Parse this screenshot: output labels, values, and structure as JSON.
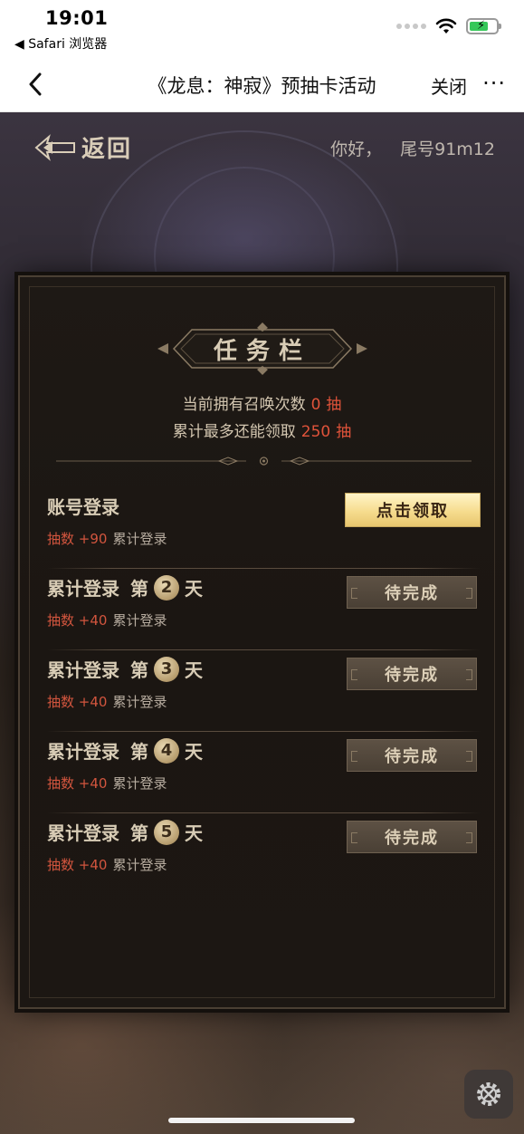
{
  "status_bar": {
    "time": "19:01",
    "back_app": "◀ Safari 浏览器",
    "battery_color": "#35c759"
  },
  "nav_bar": {
    "title": "《龙息：神寂》预抽卡活动",
    "close_label": "关闭",
    "more_label": "···"
  },
  "game_header": {
    "back_label": "返回",
    "greeting": "你好，",
    "tail_label": "尾号91m12"
  },
  "panel": {
    "title": "任务栏",
    "summary": {
      "current_prefix": "当前拥有召唤次数",
      "current_value": "0",
      "current_unit": "抽",
      "max_prefix": "累计最多还能领取",
      "max_value": "250",
      "max_unit": "抽"
    },
    "tasks": [
      {
        "title": "账号登录",
        "day": "",
        "reward": "抽数 +90",
        "desc": "累计登录",
        "button": "点击领取",
        "status": "claimable"
      },
      {
        "title_prefix": "累计登录",
        "title_mid": "第",
        "day": "2",
        "title_suffix": "天",
        "reward": "抽数 +40",
        "desc": "累计登录",
        "button": "待完成",
        "status": "pending"
      },
      {
        "title_prefix": "累计登录",
        "title_mid": "第",
        "day": "3",
        "title_suffix": "天",
        "reward": "抽数 +40",
        "desc": "累计登录",
        "button": "待完成",
        "status": "pending"
      },
      {
        "title_prefix": "累计登录",
        "title_mid": "第",
        "day": "4",
        "title_suffix": "天",
        "reward": "抽数 +40",
        "desc": "累计登录",
        "button": "待完成",
        "status": "pending"
      },
      {
        "title_prefix": "累计登录",
        "title_mid": "第",
        "day": "5",
        "title_suffix": "天",
        "reward": "抽数 +40",
        "desc": "累计登录",
        "button": "待完成",
        "status": "pending"
      }
    ]
  },
  "colors": {
    "accent_red": "#e0533a",
    "gold_button": "#f6dc8e",
    "panel_bg": "#1b1612"
  }
}
